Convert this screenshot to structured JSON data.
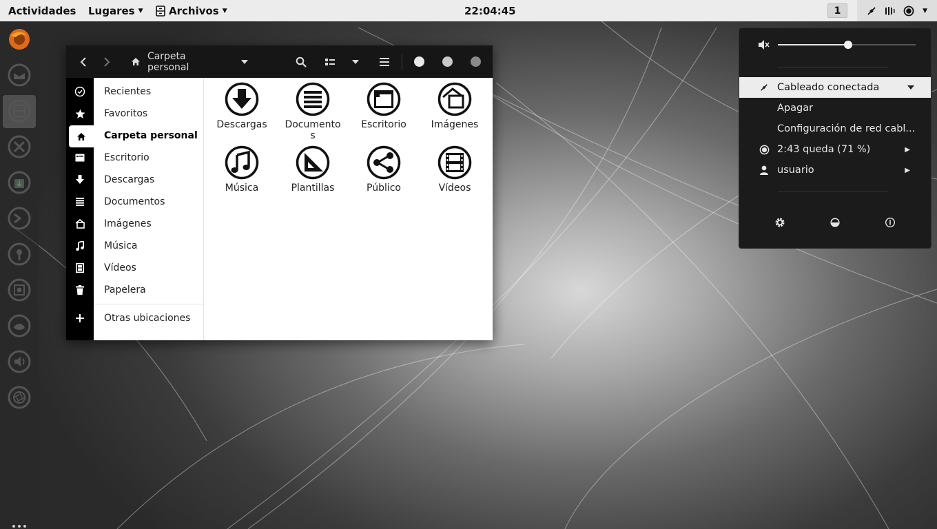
{
  "topbar": {
    "activities": "Actividades",
    "places": "Lugares",
    "files_app": "Archivos",
    "clock": "22:04:45",
    "workspace": "1"
  },
  "file_manager": {
    "location": "Carpeta personal",
    "sidebar": [
      {
        "label": "Recientes",
        "icon": "clock-icon"
      },
      {
        "label": "Favoritos",
        "icon": "star-icon"
      },
      {
        "label": "Carpeta personal",
        "icon": "home-icon",
        "active": true
      },
      {
        "label": "Escritorio",
        "icon": "desktop-icon"
      },
      {
        "label": "Descargas",
        "icon": "download-icon"
      },
      {
        "label": "Documentos",
        "icon": "document-icon"
      },
      {
        "label": "Imágenes",
        "icon": "image-icon"
      },
      {
        "label": "Música",
        "icon": "music-icon"
      },
      {
        "label": "Vídeos",
        "icon": "video-icon"
      },
      {
        "label": "Papelera",
        "icon": "trash-icon"
      }
    ],
    "other_locations": "Otras ubicaciones",
    "folders": [
      {
        "label": "Descargas",
        "icon": "download-folder-icon"
      },
      {
        "label": "Documentos",
        "icon": "documents-folder-icon"
      },
      {
        "label": "Escritorio",
        "icon": "desktop-folder-icon"
      },
      {
        "label": "Imágenes",
        "icon": "pictures-folder-icon"
      },
      {
        "label": "Música",
        "icon": "music-folder-icon"
      },
      {
        "label": "Plantillas",
        "icon": "templates-folder-icon"
      },
      {
        "label": "Público",
        "icon": "public-share-folder-icon"
      },
      {
        "label": "Vídeos",
        "icon": "videos-folder-icon"
      }
    ]
  },
  "system_menu": {
    "volume_level": 0.51,
    "network": "Cableado conectada",
    "network_off": "Apagar",
    "network_settings": "Configuración de red cabl...",
    "battery": "2:43 queda (71 %)",
    "user": "usuario"
  }
}
